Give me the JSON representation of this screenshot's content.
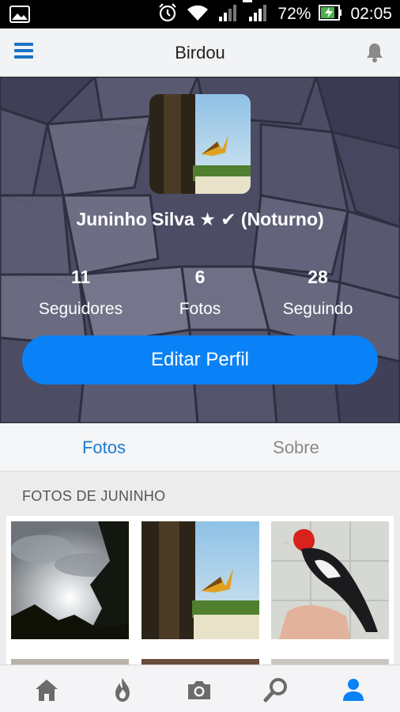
{
  "status_bar": {
    "battery_percent": "72%",
    "time": "02:05",
    "sim_badge": "2",
    "icons": [
      "gallery-icon",
      "alarm-icon",
      "wifi-icon",
      "signal-icon",
      "signal-icon",
      "battery-charging-icon"
    ]
  },
  "app_bar": {
    "title": "Birdou",
    "menu_icon": "hamburger-menu-icon",
    "notification_icon": "bell-icon"
  },
  "profile": {
    "name": "Juninho Silva ★ ✔ (Noturno)",
    "stats": [
      {
        "value": "11",
        "label": "Seguidores"
      },
      {
        "value": "6",
        "label": "Fotos"
      },
      {
        "value": "28",
        "label": "Seguindo"
      }
    ],
    "edit_button": "Editar Perfil"
  },
  "tabs": [
    {
      "label": "Fotos",
      "active": true
    },
    {
      "label": "Sobre",
      "active": false
    }
  ],
  "photos_section": {
    "title": "FOTOS DE JUNINHO"
  },
  "bottom_nav": {
    "items": [
      "home-icon",
      "flame-icon",
      "camera-icon",
      "search-icon",
      "profile-icon"
    ],
    "active": "profile-icon"
  },
  "colors": {
    "accent": "#0a82f7",
    "tab_active": "#1a7bd0",
    "header_bg": "#4b4c63",
    "nav_icon": "#6b6b6b"
  }
}
